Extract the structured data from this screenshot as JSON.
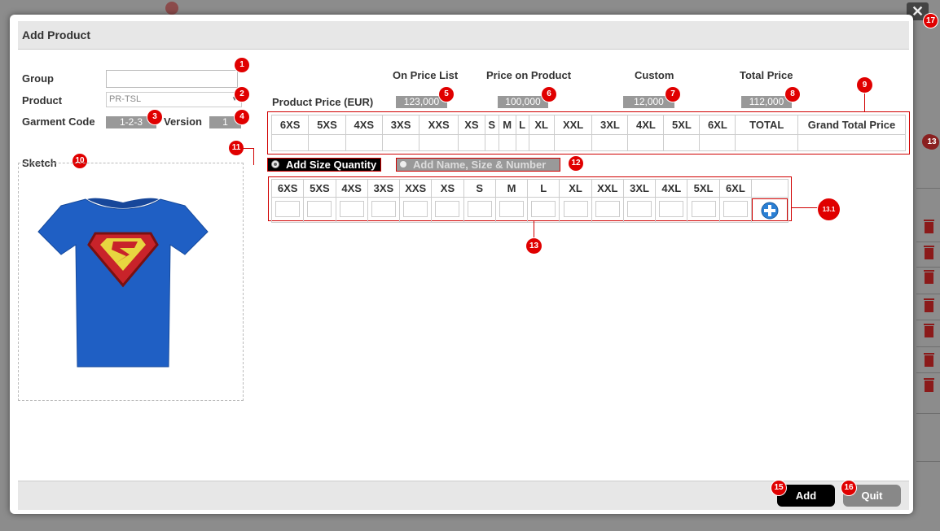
{
  "dialog": {
    "title": "Add Product",
    "close_glyph": "✕"
  },
  "form": {
    "group_label": "Group",
    "group_value": "",
    "product_label": "Product",
    "product_value": "PR-TSL",
    "garment_code_label": "Garment Code",
    "garment_code_value": "1-2-3",
    "version_label": "Version",
    "version_value": "1"
  },
  "prices": {
    "row_label": "Product Price (EUR)",
    "headers": [
      "On Price List",
      "Price on Product",
      "Custom",
      "Total Price"
    ],
    "values": [
      "123,000",
      "100,000",
      "12,000",
      "112,000"
    ]
  },
  "summary_table": {
    "headers": [
      "6XS",
      "5XS",
      "4XS",
      "3XS",
      "XXS",
      "XS",
      "S",
      "M",
      "L",
      "XL",
      "XXL",
      "3XL",
      "4XL",
      "5XL",
      "6XL",
      "TOTAL",
      "Grand Total Price"
    ]
  },
  "options": {
    "size_quantity_label": "Add Size Quantity",
    "name_size_number_label": "Add Name, Size & Number",
    "selected": "size_quantity"
  },
  "quantity_table": {
    "headers": [
      "6XS",
      "5XS",
      "4XS",
      "3XS",
      "XXS",
      "XS",
      "S",
      "M",
      "L",
      "XL",
      "XXL",
      "3XL",
      "4XL",
      "5XL",
      "6XL"
    ],
    "add_icon": "plus-circle-icon"
  },
  "sketch": {
    "label": "Sketch",
    "image": "superman-tshirt"
  },
  "footer": {
    "add_label": "Add",
    "quit_label": "Quit"
  },
  "badges": {
    "b1": "1",
    "b2": "2",
    "b3": "3",
    "b4": "4",
    "b5": "5",
    "b6": "6",
    "b7": "7",
    "b8": "8",
    "b9": "9",
    "b10": "10",
    "b11": "11",
    "b12": "12",
    "b13": "13",
    "b13_1": "13.1",
    "b15": "15",
    "b16": "16",
    "b17": "17",
    "bg13": "13"
  },
  "colors": {
    "badge": "#e00000",
    "annotation": "#d00000",
    "add_button": "#000000",
    "quit_button": "#888888",
    "shirt": "#1f5fc4"
  }
}
